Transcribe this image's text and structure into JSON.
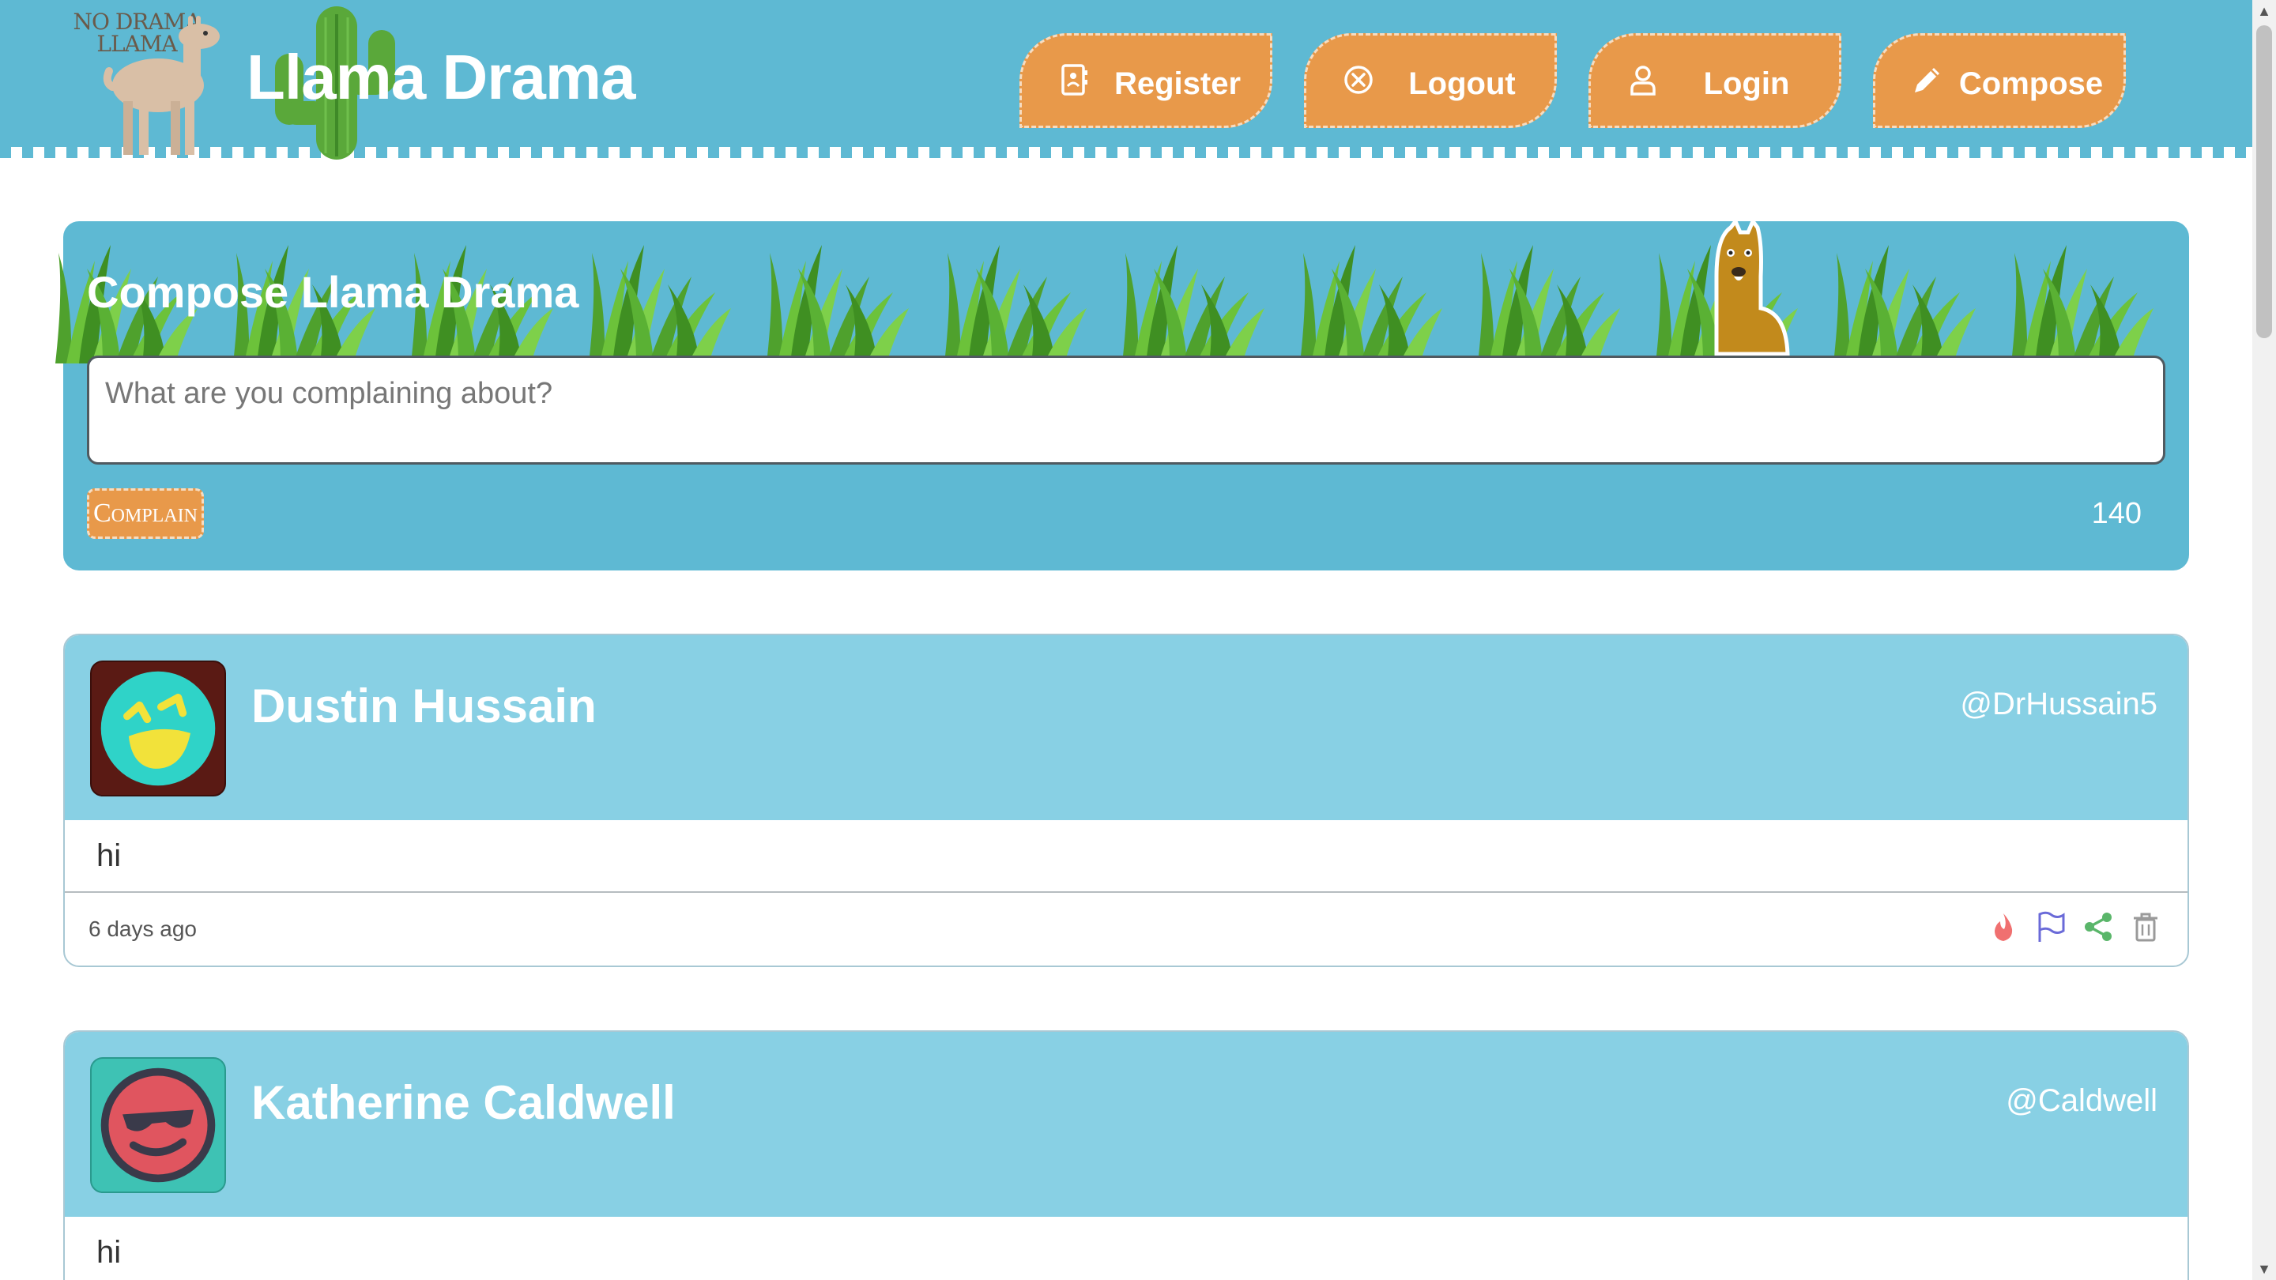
{
  "header": {
    "logo_line1": "NO DRAMA",
    "logo_line2": "LLAMA",
    "title": "Llama Drama",
    "nav": [
      {
        "label": "Register",
        "icon": "address-book-icon"
      },
      {
        "label": "Logout",
        "icon": "close-circle-icon"
      },
      {
        "label": "Login",
        "icon": "user-icon"
      },
      {
        "label": "Compose",
        "icon": "pencil-icon"
      }
    ]
  },
  "compose": {
    "title": "Compose Llama Drama",
    "placeholder": "What are you complaining about?",
    "button_label": "Complain",
    "char_count": "140"
  },
  "posts": [
    {
      "name": "Dustin Hussain",
      "handle": "@DrHussain5",
      "body": "hi",
      "time": "6 days ago",
      "avatar_bg": "#5a1a14",
      "avatar_face": "#2fd3c8",
      "avatar_features": "#f2e23a"
    },
    {
      "name": "Katherine Caldwell",
      "handle": "@Caldwell",
      "body": "hi",
      "avatar_bg": "#3ec2b4",
      "avatar_face": "#e0555f",
      "avatar_features": "#3a3a4a"
    }
  ],
  "colors": {
    "header": "#5eb9d3",
    "accent": "#e8994a",
    "post_head": "#88d0e4"
  },
  "actions": [
    "fire-icon",
    "flag-icon",
    "share-icon",
    "trash-icon"
  ]
}
